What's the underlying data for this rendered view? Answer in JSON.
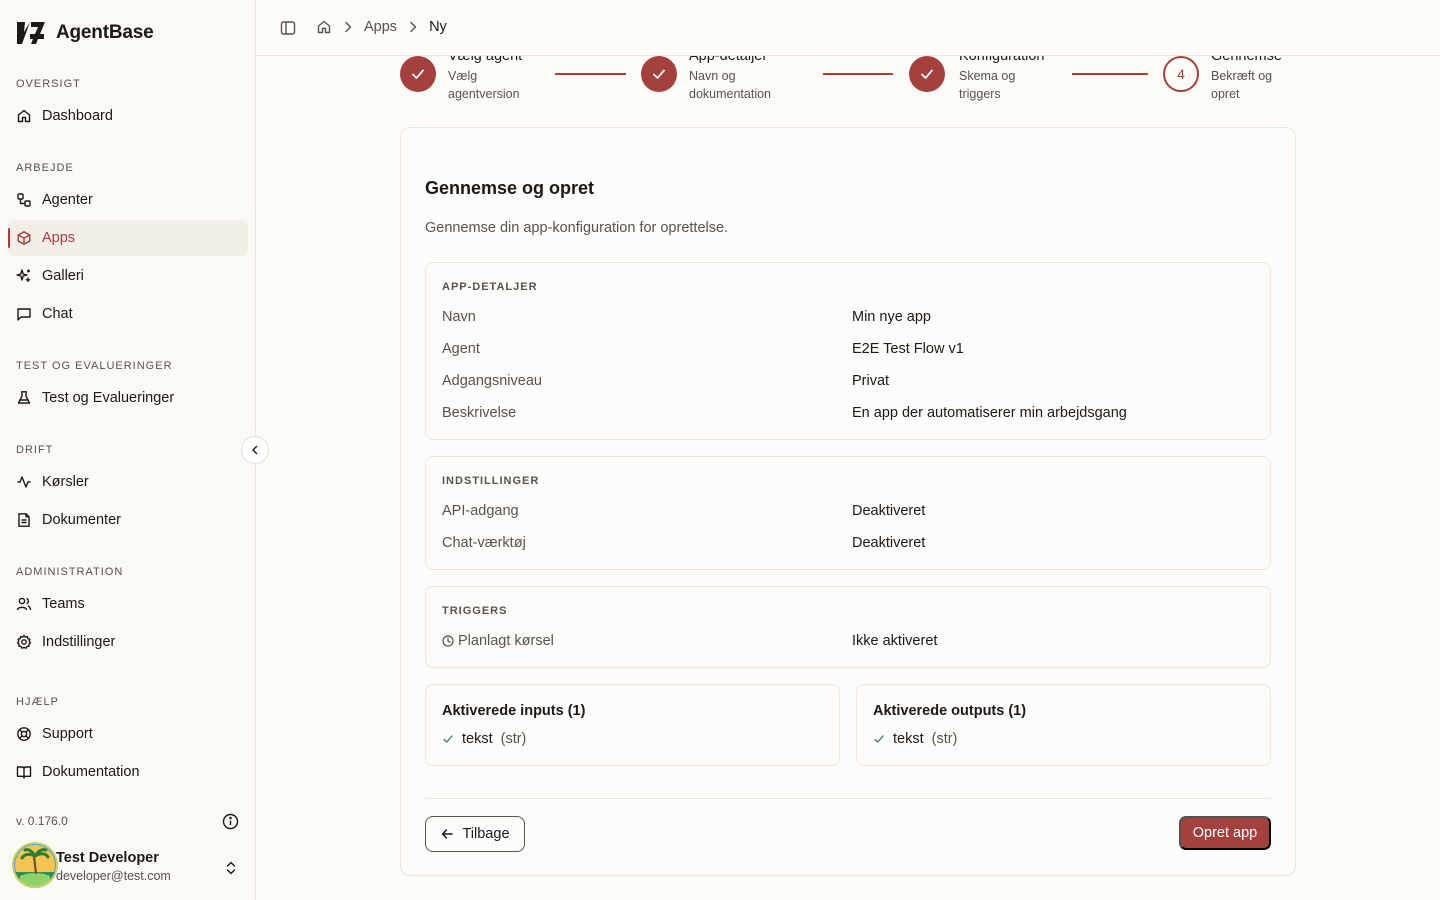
{
  "brand": {
    "name": "AgentBase"
  },
  "sidebar": {
    "sections": [
      {
        "label": "OVERSIGT",
        "items": [
          {
            "label": "Dashboard",
            "icon": "home-icon"
          }
        ]
      },
      {
        "label": "ARBEJDE",
        "items": [
          {
            "label": "Agenter",
            "icon": "workflow-icon"
          },
          {
            "label": "Apps",
            "icon": "box-icon",
            "active": true
          },
          {
            "label": "Galleri",
            "icon": "sparkles-icon"
          },
          {
            "label": "Chat",
            "icon": "chat-icon"
          }
        ]
      },
      {
        "label": "TEST OG EVALUERINGER",
        "items": [
          {
            "label": "Test og Evalueringer",
            "icon": "flask-icon"
          }
        ]
      },
      {
        "label": "DRIFT",
        "items": [
          {
            "label": "Kørsler",
            "icon": "activity-icon"
          },
          {
            "label": "Dokumenter",
            "icon": "document-icon"
          }
        ]
      },
      {
        "label": "ADMINISTRATION",
        "items": [
          {
            "label": "Teams",
            "icon": "users-icon"
          },
          {
            "label": "Indstillinger",
            "icon": "gear-icon"
          }
        ]
      },
      {
        "label": "HJÆLP",
        "items": [
          {
            "label": "Support",
            "icon": "lifebuoy-icon"
          },
          {
            "label": "Dokumentation",
            "icon": "book-icon"
          }
        ]
      }
    ],
    "version": "v. 0.176.0",
    "user": {
      "name": "Test Developer",
      "email": "developer@test.com"
    }
  },
  "header": {
    "breadcrumb": [
      "Apps",
      "Ny"
    ]
  },
  "stepper": {
    "steps": [
      {
        "title": "Vælg agent",
        "subtitle": "Vælg agentversion",
        "status": "done"
      },
      {
        "title": "App-detaljer",
        "subtitle": "Navn og dokumentation",
        "status": "done"
      },
      {
        "title": "Konfiguration",
        "subtitle": "Skema og triggers",
        "status": "done"
      },
      {
        "title": "Gennemse",
        "subtitle": "Bekræft og opret",
        "status": "current",
        "number": "4"
      }
    ]
  },
  "review": {
    "title": "Gennemse og opret",
    "description": "Gennemse din app-konfiguration for oprettelse.",
    "details": {
      "label": "APP-DETALJER",
      "rows": [
        {
          "key": "Navn",
          "value": "Min nye app"
        },
        {
          "key": "Agent",
          "value": "E2E Test Flow v1"
        },
        {
          "key": "Adgangsniveau",
          "value": "Privat"
        },
        {
          "key": "Beskrivelse",
          "value": "En app der automatiserer min arbejdsgang"
        }
      ]
    },
    "settings": {
      "label": "INDSTILLINGER",
      "rows": [
        {
          "key": "API-adgang",
          "value": "Deaktiveret"
        },
        {
          "key": "Chat-værktøj",
          "value": "Deaktiveret"
        }
      ]
    },
    "triggers": {
      "label": "TRIGGERS",
      "rows": [
        {
          "key": "Planlagt kørsel",
          "value": "Ikke aktiveret"
        }
      ]
    },
    "inputs": {
      "title": "Aktiverede inputs (1)",
      "name": "tekst",
      "type": "(str)"
    },
    "outputs": {
      "title": "Aktiverede outputs (1)",
      "name": "tekst",
      "type": "(str)"
    },
    "back_label": "Tilbage",
    "create_label": "Opret app"
  },
  "colors": {
    "accent": "#a4413e",
    "border": "#ebe7e0",
    "muted": "#57534e"
  }
}
